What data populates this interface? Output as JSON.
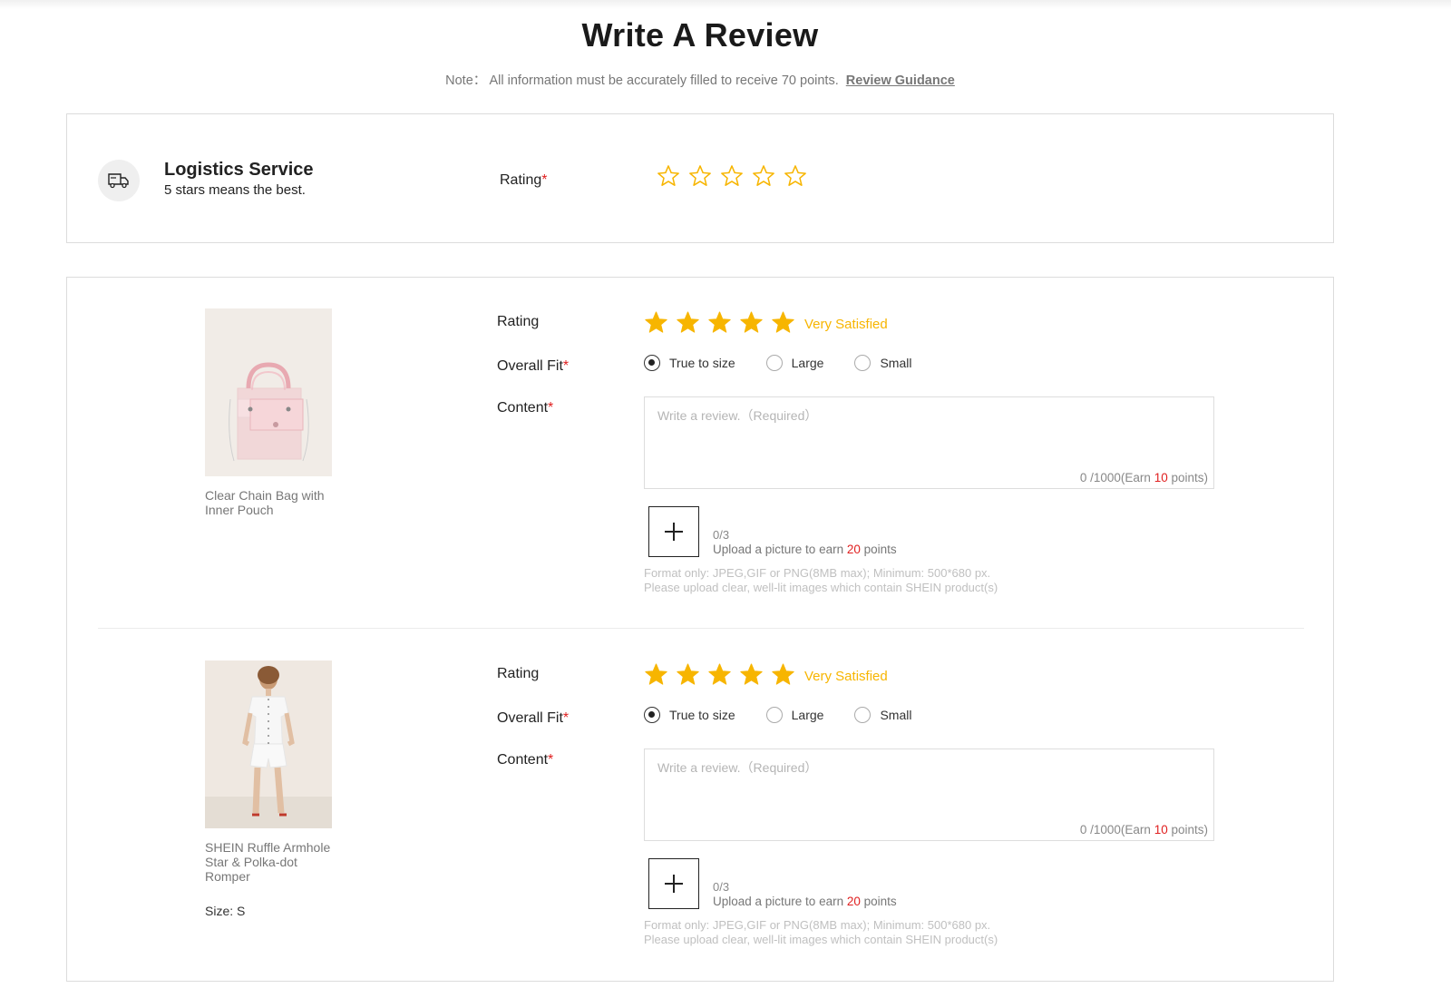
{
  "header": {
    "title": "Write A Review",
    "note_text": "Note： All information must be accurately filled to receive 70 points.",
    "guidance_link": "Review Guidance"
  },
  "logistics": {
    "icon": "truck-icon",
    "title": "Logistics Service",
    "subtitle": "5 stars means the best.",
    "rating_label": "Rating",
    "required_mark": "*",
    "rating_value": 0,
    "rating_max": 5
  },
  "colors": {
    "star": "#f7b500",
    "required": "#e02020",
    "accent_text": "#f7b500"
  },
  "products": [
    {
      "name": "Clear Chain Bag with Inner Pouch",
      "size": "",
      "rating_label": "Rating",
      "rating_value": 5,
      "rating_text": "Very Satisfied",
      "fit_label": "Overall Fit",
      "fit_options": [
        "True to size",
        "Large",
        "Small"
      ],
      "fit_selected": "True to size",
      "content_label": "Content",
      "required_mark": "*",
      "content_placeholder": "Write a review.（Required）",
      "content_value": "",
      "counter_prefix": "0 /1000(Earn ",
      "counter_points": "10",
      "counter_suffix": " points)",
      "upload_count": "0/3",
      "upload_prefix": "Upload a picture to earn ",
      "upload_points": "20",
      "upload_suffix": " points",
      "format_line1": "Format only: JPEG,GIF or PNG(8MB max); Minimum: 500*680 px.",
      "format_line2": "Please upload clear, well-lit images which contain SHEIN product(s)"
    },
    {
      "name": "SHEIN Ruffle Armhole Star & Polka-dot Romper",
      "size": "Size: S",
      "rating_label": "Rating",
      "rating_value": 5,
      "rating_text": "Very Satisfied",
      "fit_label": "Overall Fit",
      "fit_options": [
        "True to size",
        "Large",
        "Small"
      ],
      "fit_selected": "True to size",
      "content_label": "Content",
      "required_mark": "*",
      "content_placeholder": "Write a review.（Required）",
      "content_value": "",
      "counter_prefix": "0 /1000(Earn ",
      "counter_points": "10",
      "counter_suffix": " points)",
      "upload_count": "0/3",
      "upload_prefix": "Upload a picture to earn ",
      "upload_points": "20",
      "upload_suffix": " points",
      "format_line1": "Format only: JPEG,GIF or PNG(8MB max); Minimum: 500*680 px.",
      "format_line2": "Please upload clear, well-lit images which contain SHEIN product(s)"
    }
  ]
}
